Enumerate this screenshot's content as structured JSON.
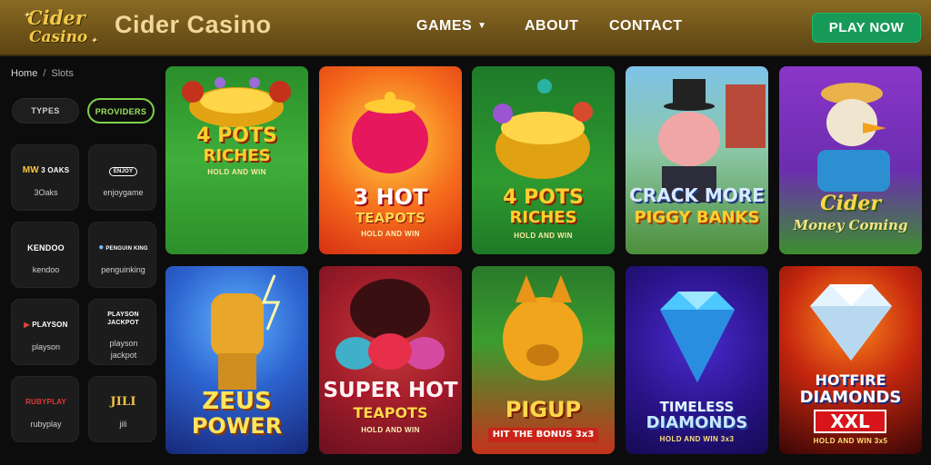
{
  "header": {
    "logo_line1": "Cider",
    "logo_line2": "Casino",
    "brand": "Cider Casino",
    "nav": {
      "games": "GAMES",
      "about": "ABOUT",
      "contact": "CONTACT"
    },
    "play_button": "PLAY NOW"
  },
  "breadcrumb": {
    "home": "Home",
    "separator": "/",
    "current": "Slots"
  },
  "filter_tabs": {
    "types": "TYPES",
    "providers": "PROVIDERS"
  },
  "providers": [
    {
      "logo": "3 OAKS",
      "name": "3Oaks"
    },
    {
      "logo": "ENJOY",
      "name": "enjoygame"
    },
    {
      "logo": "KENDOO",
      "name": "kendoo"
    },
    {
      "logo": "PENGUIN KING",
      "name": "penguinking"
    },
    {
      "logo": "PLAYSON",
      "name": "playson"
    },
    {
      "logo": "PLAYSON JACKPOT",
      "name": "playson jackpot"
    },
    {
      "logo": "RUBYPLAY",
      "name": "rubyplay"
    },
    {
      "logo": "JILI",
      "name": "jili"
    }
  ],
  "games": [
    {
      "t1": "4 POTS",
      "t2": "RICHES",
      "sub": "HOLD AND WIN"
    },
    {
      "t1": "3 HOT",
      "t2": "TEAPOTS",
      "sub": "HOLD AND WIN"
    },
    {
      "t1": "4 POTS",
      "t2": "RICHES",
      "sub": "HOLD AND WIN"
    },
    {
      "t1": "CRACK MORE",
      "t2": "PIGGY BANKS",
      "sub": ""
    },
    {
      "t1": "Cider",
      "t2": "Money Coming",
      "sub": ""
    },
    {
      "t1": "ZEUS",
      "t2": "POWER",
      "sub": ""
    },
    {
      "t1": "SUPER HOT",
      "t2": "TEAPOTS",
      "sub": "HOLD AND WIN"
    },
    {
      "t1": "PIGUP",
      "t2": "HIT THE BONUS 3x3",
      "sub": ""
    },
    {
      "t1": "TIMELESS",
      "t2": "DIAMONDS",
      "sub": "HOLD AND WIN 3x3"
    },
    {
      "t1": "HOTFIRE",
      "t2": "DIAMONDS",
      "t3": "XXL",
      "sub": "HOLD AND WIN 3x5"
    }
  ],
  "colors": {
    "header_gold": "#7a5d1f",
    "play_green": "#179a58",
    "providers_accent": "#7ed34b",
    "brand_text": "#f1d79a"
  }
}
